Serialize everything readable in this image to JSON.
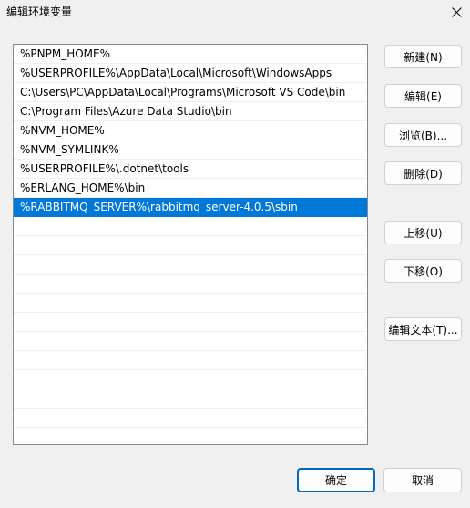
{
  "window": {
    "title": "编辑环境变量"
  },
  "path_list": {
    "items": [
      "%PNPM_HOME%",
      "%USERPROFILE%\\AppData\\Local\\Microsoft\\WindowsApps",
      "C:\\Users\\PC\\AppData\\Local\\Programs\\Microsoft VS Code\\bin",
      "C:\\Program Files\\Azure Data Studio\\bin",
      "%NVM_HOME%",
      "%NVM_SYMLINK%",
      "%USERPROFILE%\\.dotnet\\tools",
      "%ERLANG_HOME%\\bin",
      "%RABBITMQ_SERVER%\\rabbitmq_server-4.0.5\\sbin"
    ],
    "selected_index": 8,
    "selected_color": "#0078d7"
  },
  "buttons": {
    "new": "新建(N)",
    "edit": "编辑(E)",
    "browse": "浏览(B)...",
    "delete": "删除(D)",
    "move_up": "上移(U)",
    "move_down": "下移(O)",
    "edit_text": "编辑文本(T)...",
    "ok": "确定",
    "cancel": "取消"
  }
}
